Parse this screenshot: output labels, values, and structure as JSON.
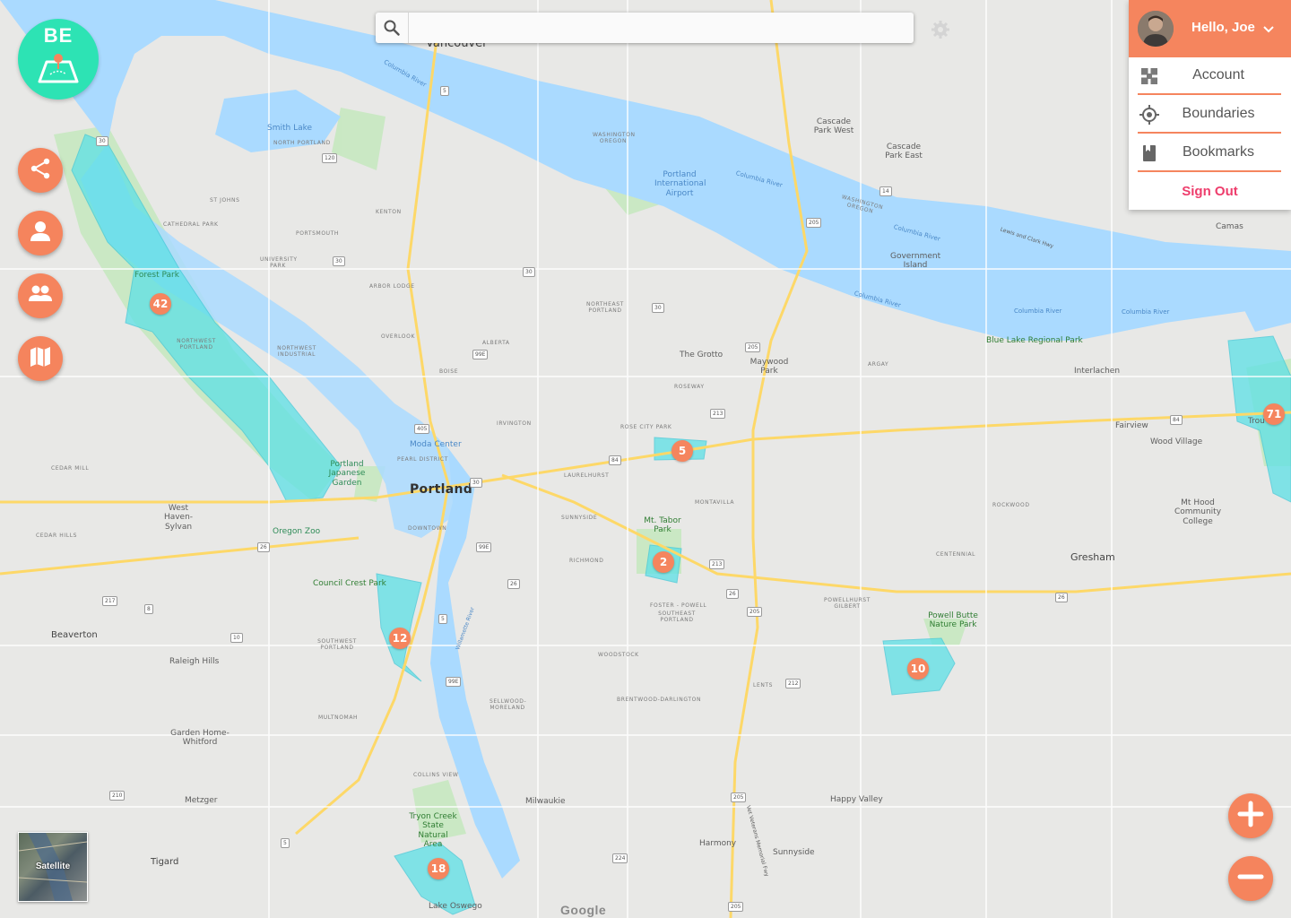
{
  "app": {
    "logo_text": "BE",
    "colors": {
      "accent": "#f5855e",
      "brand": "#2de3b4",
      "boundary": "#5de0e6",
      "signout": "#ee3d6c",
      "water": "#aadaff"
    }
  },
  "search": {
    "placeholder": "",
    "value": ""
  },
  "sidebar": {
    "buttons": [
      {
        "name": "share-icon"
      },
      {
        "name": "user-icon"
      },
      {
        "name": "group-icon"
      },
      {
        "name": "map-icon"
      }
    ]
  },
  "user_menu": {
    "greeting": "Hello, Joe",
    "items": [
      {
        "label": "Account",
        "icon": "account-icon"
      },
      {
        "label": "Boundaries",
        "icon": "target-icon"
      },
      {
        "label": "Bookmarks",
        "icon": "bookmark-icon"
      }
    ],
    "sign_out": "Sign Out"
  },
  "map": {
    "satellite_label": "Satellite",
    "attribution": "Google",
    "markers": [
      "42",
      "5",
      "2",
      "12",
      "10",
      "18",
      "71"
    ],
    "labels": {
      "vancouver": "Vancouver",
      "smith_lake": "Smith Lake",
      "north_portland": "NORTH PORTLAND",
      "st_johns": "ST JOHNS",
      "cathedral_park": "CATHEDRAL PARK",
      "kenton": "KENTON",
      "portsmouth": "PORTSMOUTH",
      "university_park": "UNIVERSITY PARK",
      "arbor_lodge": "ARBOR LODGE",
      "overlook": "OVERLOOK",
      "northwest_industrial": "NORTHWEST INDUSTRIAL",
      "forest_park": "Forest Park",
      "northwest_portland": "NORTHWEST PORTLAND",
      "cedar_mill": "CEDAR MILL",
      "cedar_hills": "CEDAR HILLS",
      "west_haven": "West Haven-Sylvan",
      "portland_japanese": "Portland Japanese Garden",
      "oregon_zoo": "Oregon Zoo",
      "moda_center": "Moda Center",
      "pearl_district": "PEARL DISTRICT",
      "portland": "Portland",
      "downtown": "DOWNTOWN",
      "boise": "BOISE",
      "alberta": "ALBERTA",
      "irvington": "IRVINGTON",
      "northeast_portland": "NORTHEAST PORTLAND",
      "rose_city_park": "ROSE CITY PARK",
      "laurelhurst": "LAURELHURST",
      "sunnyside": "SUNNYSIDE",
      "richmond": "RICHMOND",
      "mt_tabor": "Mt. Tabor Park",
      "montavilla": "MONTAVILLA",
      "roseway": "ROSEWAY",
      "the_grotto": "The Grotto",
      "maywood_park": "Maywood Park",
      "argay": "ARGAY",
      "portland_airport": "Portland International Airport",
      "washington_oregon_1": "WASHINGTON OREGON",
      "washington_oregon_2": "WASHINGTON OREGON",
      "columbia_river_1": "Columbia River",
      "columbia_river_2": "Columbia River",
      "columbia_river_3": "Columbia River",
      "columbia_river_4": "Columbia River",
      "columbia_river_5": "Columbia River",
      "columbia_river_6": "Columbia River",
      "cascade_park_west": "Cascade Park West",
      "cascade_park_east": "Cascade Park East",
      "lewis_clark": "Lewis and Clark Hwy",
      "government_island": "Government Island",
      "camas": "Camas",
      "blue_lake": "Blue Lake Regional Park",
      "interlachen": "Interlachen",
      "fairview": "Fairview",
      "wood_village": "Wood Village",
      "troutdale": "Trou",
      "rockwood": "ROCKWOOD",
      "mt_hood_cc": "Mt Hood Community College",
      "gresham": "Gresham",
      "centennial": "CENTENNIAL",
      "powellhurst": "POWELLHURST GILBERT",
      "powell_butte": "Powell Butte Nature Park",
      "lents": "LENTS",
      "foster_powell": "FOSTER - POWELL",
      "southeast_portland": "SOUTHEAST PORTLAND",
      "woodstock": "WOODSTOCK",
      "brentwood": "BRENTWOOD-DARLINGTON",
      "sellwood": "SELLWOOD-MORELAND",
      "council_crest": "Council Crest Park",
      "southwest_portland": "SOUTHWEST PORTLAND",
      "multnomah": "MULTNOMAH",
      "willamette": "Willamette River",
      "beaverton": "Beaverton",
      "raleigh_hills": "Raleigh Hills",
      "garden_home": "Garden Home-Whitford",
      "metzger": "Metzger",
      "tigard": "Tigard",
      "collins_view": "COLLINS VIEW",
      "tryon_creek": "Tryon Creek State Natural Area",
      "lake_oswego": "Lake Oswego",
      "milwaukie": "Milwaukie",
      "happy_valley": "Happy Valley",
      "harmony": "Harmony",
      "sunnyside_city": "Sunnyside",
      "memorial_fwy": "Vet Veterans Memorial Fwy"
    },
    "shields": [
      "5",
      "5",
      "14",
      "205",
      "120",
      "30",
      "30",
      "30",
      "30",
      "205",
      "405",
      "5",
      "26",
      "99E",
      "99E",
      "99E",
      "84",
      "84",
      "217",
      "210",
      "10",
      "8",
      "224",
      "213",
      "205",
      "205",
      "205",
      "213",
      "212",
      "26",
      "26",
      "26",
      "30"
    ]
  }
}
